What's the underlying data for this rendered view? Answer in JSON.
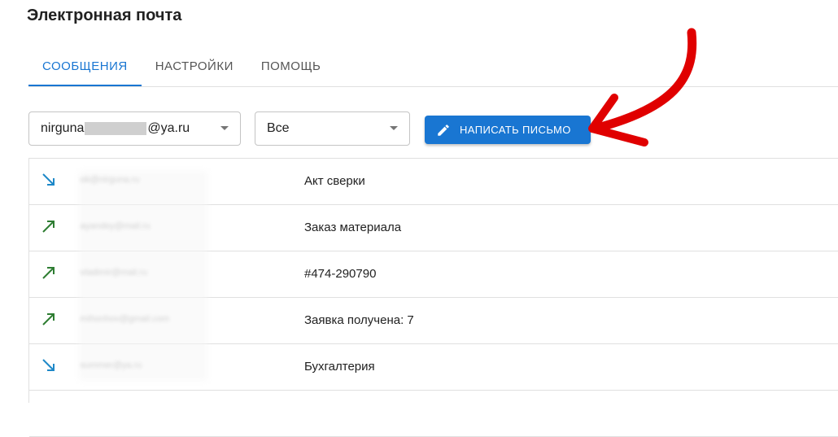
{
  "page": {
    "title": "Электронная почта"
  },
  "tabs": [
    {
      "label": "СООБЩЕНИЯ",
      "active": true
    },
    {
      "label": "НАСТРОЙКИ",
      "active": false
    },
    {
      "label": "ПОМОЩЬ",
      "active": false
    }
  ],
  "account_select": {
    "prefix": "nirguna",
    "suffix": "@ya.ru"
  },
  "filter_select": {
    "value": "Все"
  },
  "compose_button": {
    "label": "НАПИСАТЬ ПИСЬМО",
    "icon": "pencil-icon"
  },
  "messages": [
    {
      "direction": "incoming",
      "icon": "arrow-incoming-icon",
      "sender": "ok@nirguna.ru",
      "subject": "Акт сверки"
    },
    {
      "direction": "outgoing",
      "icon": "arrow-outgoing-icon",
      "sender": "ayandey@mail.ru",
      "subject": "Заказ материала"
    },
    {
      "direction": "outgoing",
      "icon": "arrow-outgoing-icon",
      "sender": "vladimir@mail.ru",
      "subject": "#474-290790"
    },
    {
      "direction": "outgoing",
      "icon": "arrow-outgoing-icon",
      "sender": "mihonhov@gmail.com",
      "subject": "Заявка получена: 7"
    },
    {
      "direction": "incoming",
      "icon": "arrow-incoming-icon",
      "sender": "summer@ya.ru",
      "subject": "Бухгалтерия"
    }
  ],
  "colors": {
    "accent": "#1976d2",
    "incoming_arrow": "#1e88c8",
    "outgoing_arrow": "#2e7d32",
    "annotation_arrow": "#e00000"
  }
}
